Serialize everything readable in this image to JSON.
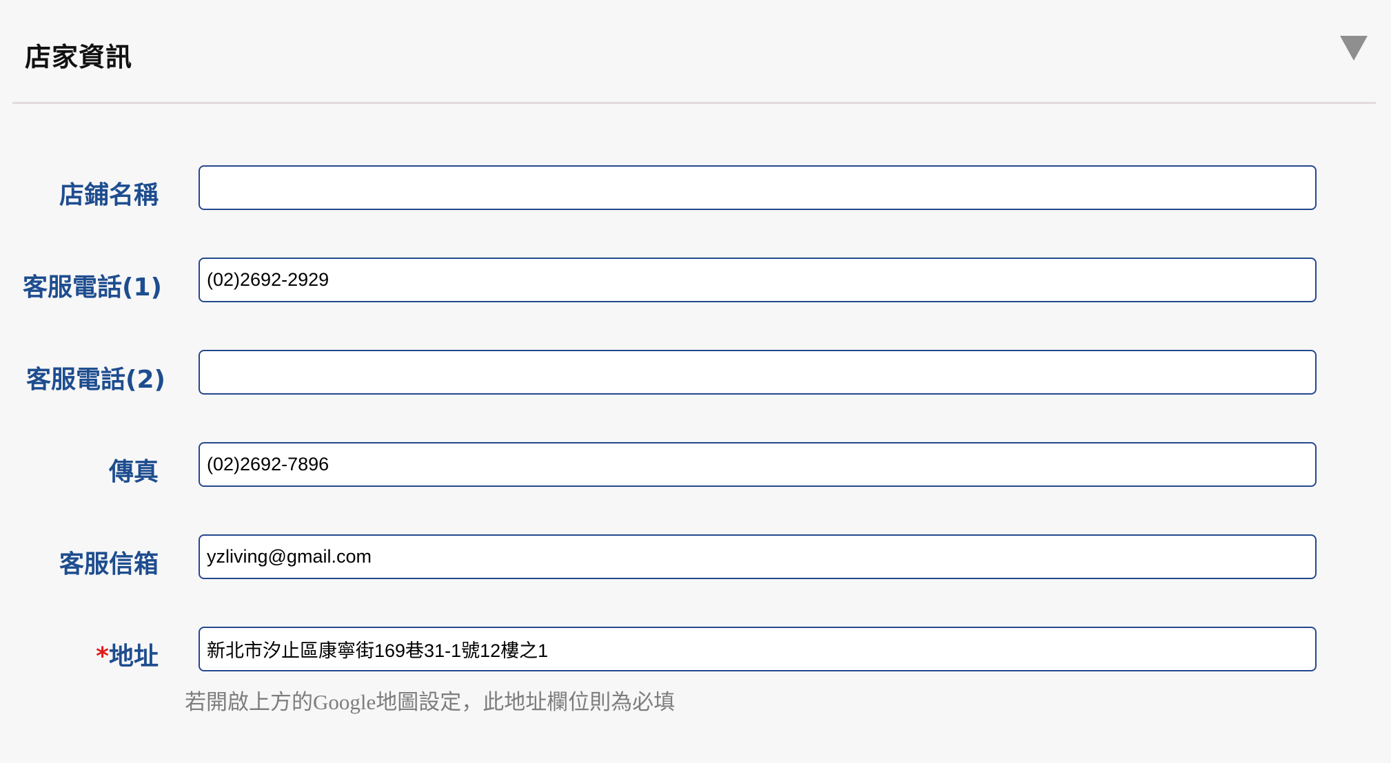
{
  "panel": {
    "title": "店家資訊",
    "toggle_icon": "triangle-down-icon",
    "divider_color": "#e2dadb"
  },
  "colors": {
    "label": "#1e4d8f",
    "required": "#e21b1b",
    "input_border": "#24478e",
    "help_text": "#7d7d7d",
    "background": "#f7f7f7"
  },
  "form": {
    "store_name": {
      "label": "店鋪名稱",
      "value": "",
      "placeholder": ""
    },
    "phone1": {
      "label": "客服電話(1)",
      "value": "(02)2692-2929"
    },
    "phone2": {
      "label": "客服電話(2)",
      "value": ""
    },
    "fax": {
      "label": "傳真",
      "value": "(02)2692-7896"
    },
    "email": {
      "label": "客服信箱",
      "value": "yzliving@gmail.com"
    },
    "address": {
      "required_mark": "*",
      "label": "地址",
      "value": "新北市汐止區康寧街169巷31-1號12樓之1",
      "help": "若開啟上方的Google地圖設定，此地址欄位則為必填"
    }
  }
}
